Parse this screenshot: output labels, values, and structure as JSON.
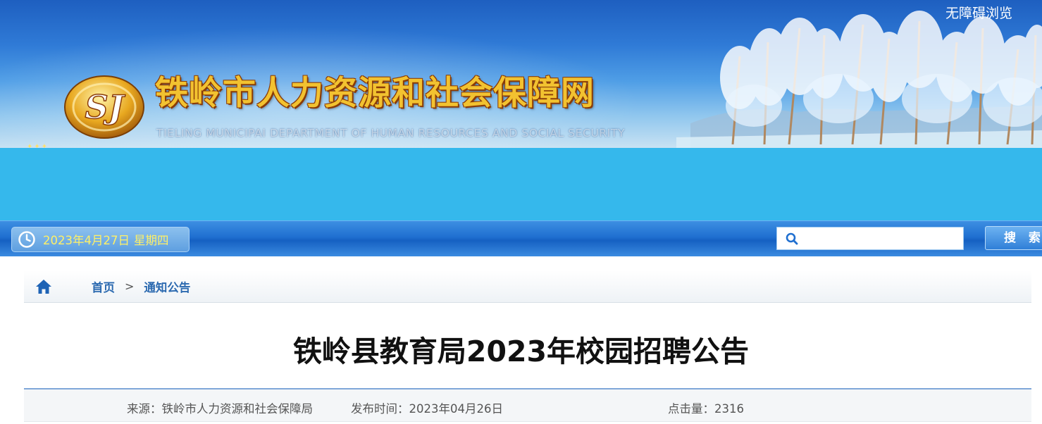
{
  "header": {
    "accessibility_link": "无障碍浏览",
    "site_title": "铁岭市人力资源和社会保障网",
    "site_subtitle": "TIELING MUNICIPAI DEPARTMENT OF HUMAN RESOURCES AND SOCIAL SECURITY",
    "logo_letters": "SJ"
  },
  "navbar": {
    "date": "2023年4月27日",
    "weekday": "星期四",
    "search_value": "",
    "search_button": "搜 索"
  },
  "breadcrumb": {
    "home": "首页",
    "separator": ">",
    "current": "通知公告"
  },
  "article": {
    "title": "铁岭县教育局2023年校园招聘公告",
    "source": "来源：铁岭市人力资源和社会保障局",
    "publish_time": "发布时间：2023年04月26日",
    "hits": "点击量：2316"
  },
  "colors": {
    "banner_top": "#1e5fc0",
    "band": "#35b8ec",
    "nav": "#1f6fd0",
    "date_text": "#fff066",
    "breadcrumb_link": "#2c6ab0",
    "title_gold": "#f2c230"
  },
  "icons": {
    "logo": "sj-emblem-icon",
    "clock": "clock-icon",
    "search": "search-icon",
    "home": "home-icon"
  }
}
